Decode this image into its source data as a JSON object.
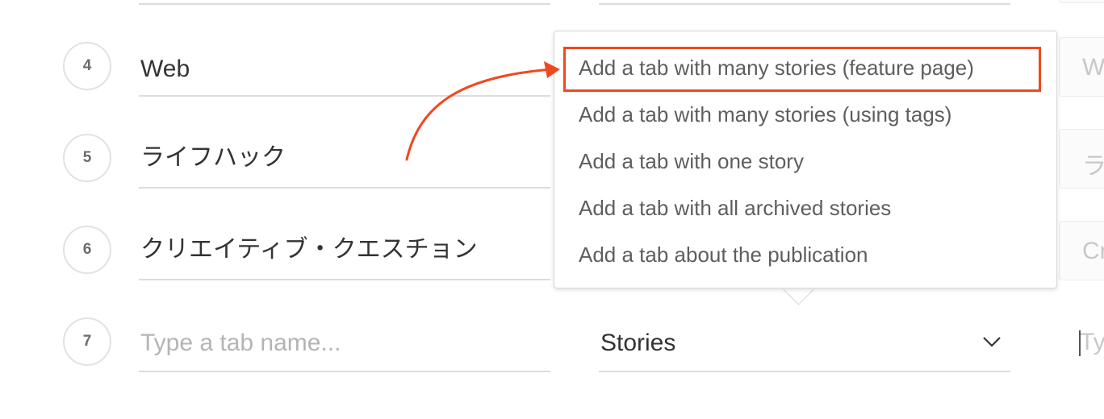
{
  "tabs": [
    {
      "number": "4",
      "name": "Web",
      "ghost": "W"
    },
    {
      "number": "5",
      "name": "ライフハック",
      "ghost": "ラ"
    },
    {
      "number": "6",
      "name": "クリエイティブ・クエスチョン",
      "ghost": "Cr"
    },
    {
      "number": "7",
      "name": "",
      "placeholder": "Type a tab name...",
      "type": "Stories",
      "ghost": "Ty"
    }
  ],
  "dropdown": {
    "options": [
      "Add a tab with many stories (feature page)",
      "Add a tab with many stories (using tags)",
      "Add a tab with one story",
      "Add a tab with all archived stories",
      "Add a tab about the publication"
    ],
    "highlighted_index": 0
  },
  "icons": {
    "select_chevron": "chevron-down-icon",
    "annotation": "red-arrow-annotation"
  },
  "colors": {
    "annotation": "#f0481e",
    "text": "#333333",
    "placeholder": "#b4b4b4",
    "divider": "#dcdcdc"
  }
}
